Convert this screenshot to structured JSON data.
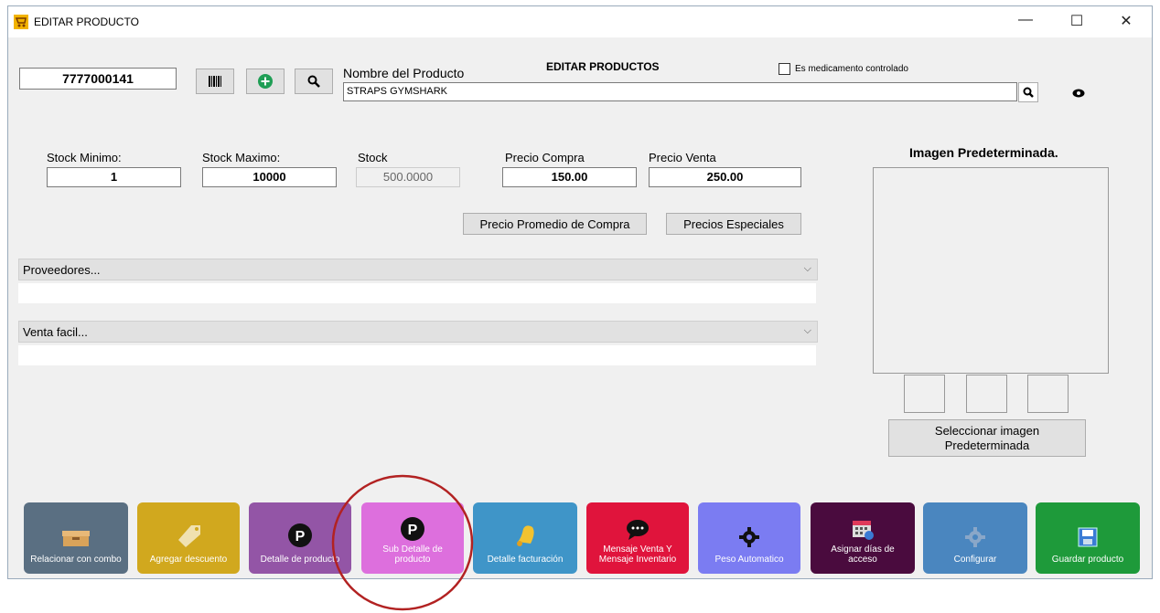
{
  "window": {
    "title": "EDITAR PRODUCTO",
    "minimize": "—",
    "maximize": "☐",
    "close": "✕"
  },
  "header": {
    "code_value": "7777000141",
    "product_name_label": "Nombre del Producto",
    "section_title": "EDITAR PRODUCTOS",
    "controlled_checkbox_label": "Es medicamento controlado",
    "product_name_value": "STRAPS GYMSHARK"
  },
  "stock": {
    "min_label": "Stock Minimo:",
    "min_value": "1",
    "max_label": "Stock Maximo:",
    "max_value": "10000",
    "stock_label": "Stock",
    "stock_value": "500.0000",
    "buy_label": "Precio Compra",
    "buy_value": "150.00",
    "sell_label": "Precio Venta",
    "sell_value": "250.00"
  },
  "buttons": {
    "avg_price": "Precio Promedio de Compra",
    "special_prices": "Precios Especiales",
    "select_image_line1": "Seleccionar imagen",
    "select_image_line2": "Predeterminada"
  },
  "combos": {
    "suppliers": "Proveedores...",
    "easy_sale": "Venta facil..."
  },
  "image_panel": {
    "title": "Imagen Predeterminada."
  },
  "tiles": [
    {
      "label": "Relacionar con combo",
      "color": "#5a6f82",
      "icon": "box-icon"
    },
    {
      "label": "Agregar descuento",
      "color": "#d1a81e",
      "icon": "tag-icon"
    },
    {
      "label": "Detalle de producto",
      "color": "#9355a6",
      "icon": "p-circle-icon"
    },
    {
      "label": "Sub Detalle de producto",
      "color": "#dd6fdd",
      "icon": "p-circle-icon"
    },
    {
      "label": "Detalle facturación",
      "color": "#3f95c8",
      "icon": "bell-icon"
    },
    {
      "label": "Mensaje Venta Y Mensaje Inventario",
      "color": "#e0143c",
      "icon": "chat-icon"
    },
    {
      "label": "Peso Automatico",
      "color": "#7b7cf2",
      "icon": "gear-icon"
    },
    {
      "label": "Asignar días de acceso",
      "color": "#4a0b3e",
      "icon": "calendar-icon"
    },
    {
      "label": "Configurar",
      "color": "#4a86bf",
      "icon": "gear-icon"
    },
    {
      "label": "Guardar producto",
      "color": "#1e9a3a",
      "icon": "floppy-icon"
    }
  ],
  "colors": {
    "highlight_circle": "#b22222"
  }
}
